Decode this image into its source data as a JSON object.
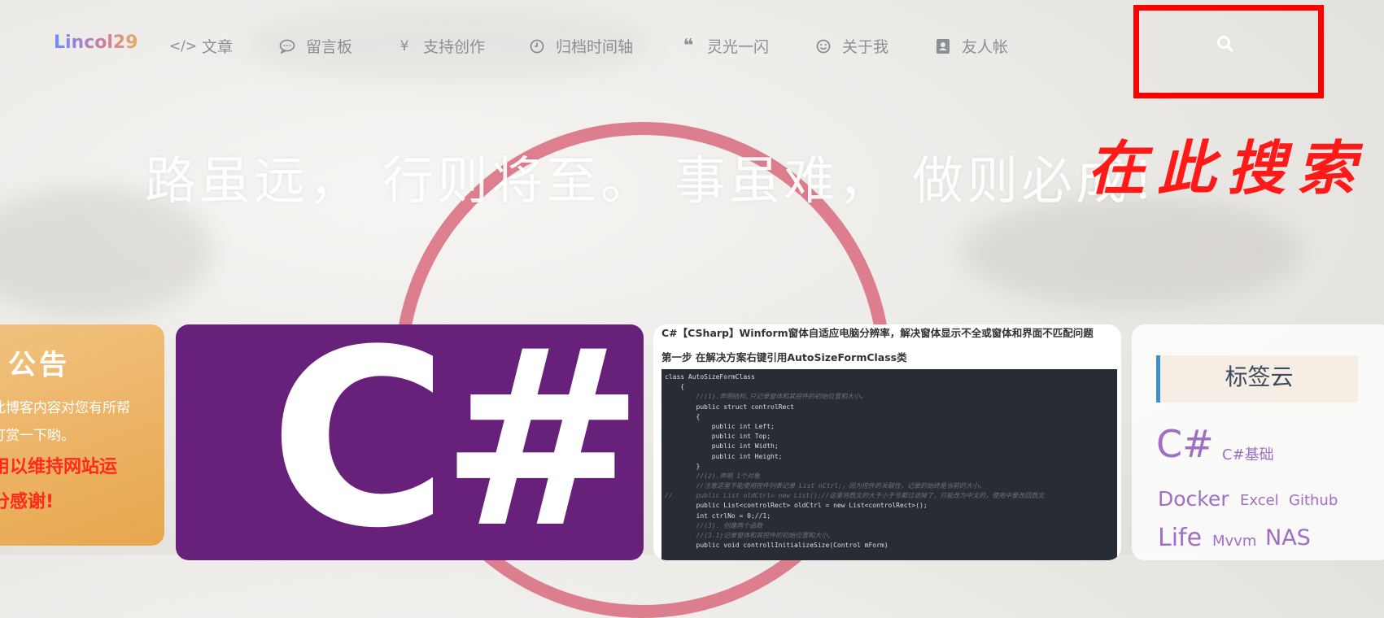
{
  "nav": {
    "brand": "Lincol29",
    "items": [
      {
        "icon": "code-icon",
        "label": "文章"
      },
      {
        "icon": "chat-bubble-icon",
        "label": "留言板"
      },
      {
        "icon": "yen-icon",
        "label": "支持创作"
      },
      {
        "icon": "clock-icon",
        "label": "归档时间轴"
      },
      {
        "icon": "quote-icon",
        "label": "灵光一闪"
      },
      {
        "icon": "smile-icon",
        "label": "关于我"
      },
      {
        "icon": "address-book-icon",
        "label": "友人帐"
      }
    ],
    "search_icon": "search-icon"
  },
  "annotation": "在此搜索",
  "hero": {
    "slogan": "路虽远，  行则将至。 事虽难，  做则必成！"
  },
  "notice": {
    "title": "公告",
    "line1": "此博客内容对您有所帮",
    "line2": "打赏一下哟。",
    "line3": "用以维持网站运",
    "line4": "分感谢!"
  },
  "featured": {
    "logo_text": "C#"
  },
  "article": {
    "title": "C#【CSharp】Winform窗体自适应电脑分辨率，解决窗体显示不全或窗体和界面不匹配问题",
    "step": "第一步 在解决方案右键引用AutoSizeFormClass类",
    "code": [
      "class AutoSizeFormClass",
      "    {",
      "        //(1).声明结构,只记录窗体和其控件的初始位置和大小。",
      "        public struct controlRect",
      "        {",
      "            public int Left;",
      "            public int Top;",
      "            public int Width;",
      "            public int Height;",
      "        }",
      "        //(2).声明 1个对象",
      "        //注意这里不能使用控件列表记录 List nCtrl;，因为控件的关联性，记录的始终是当前的大小。",
      "//      public List oldCtrl= new List();//这里将西文的大于小于号都过滤掉了，只能改为中文的，使用中要改回西文",
      "        public List<controlRect> oldCtrl = new List<controlRect>();",
      "        int ctrlNo = 0;//1;",
      "        //(3). 创建两个函数",
      "        //(3.1)记录窗体和其控件的初始位置和大小,",
      "        public void controllInitializeSize(Control mForm)"
    ]
  },
  "tagcloud": {
    "title": "标签云",
    "tags": [
      "C#",
      "C#基础",
      "Docker",
      "Excel",
      "Github",
      "Life",
      "Mvvm",
      "NAS"
    ]
  }
}
